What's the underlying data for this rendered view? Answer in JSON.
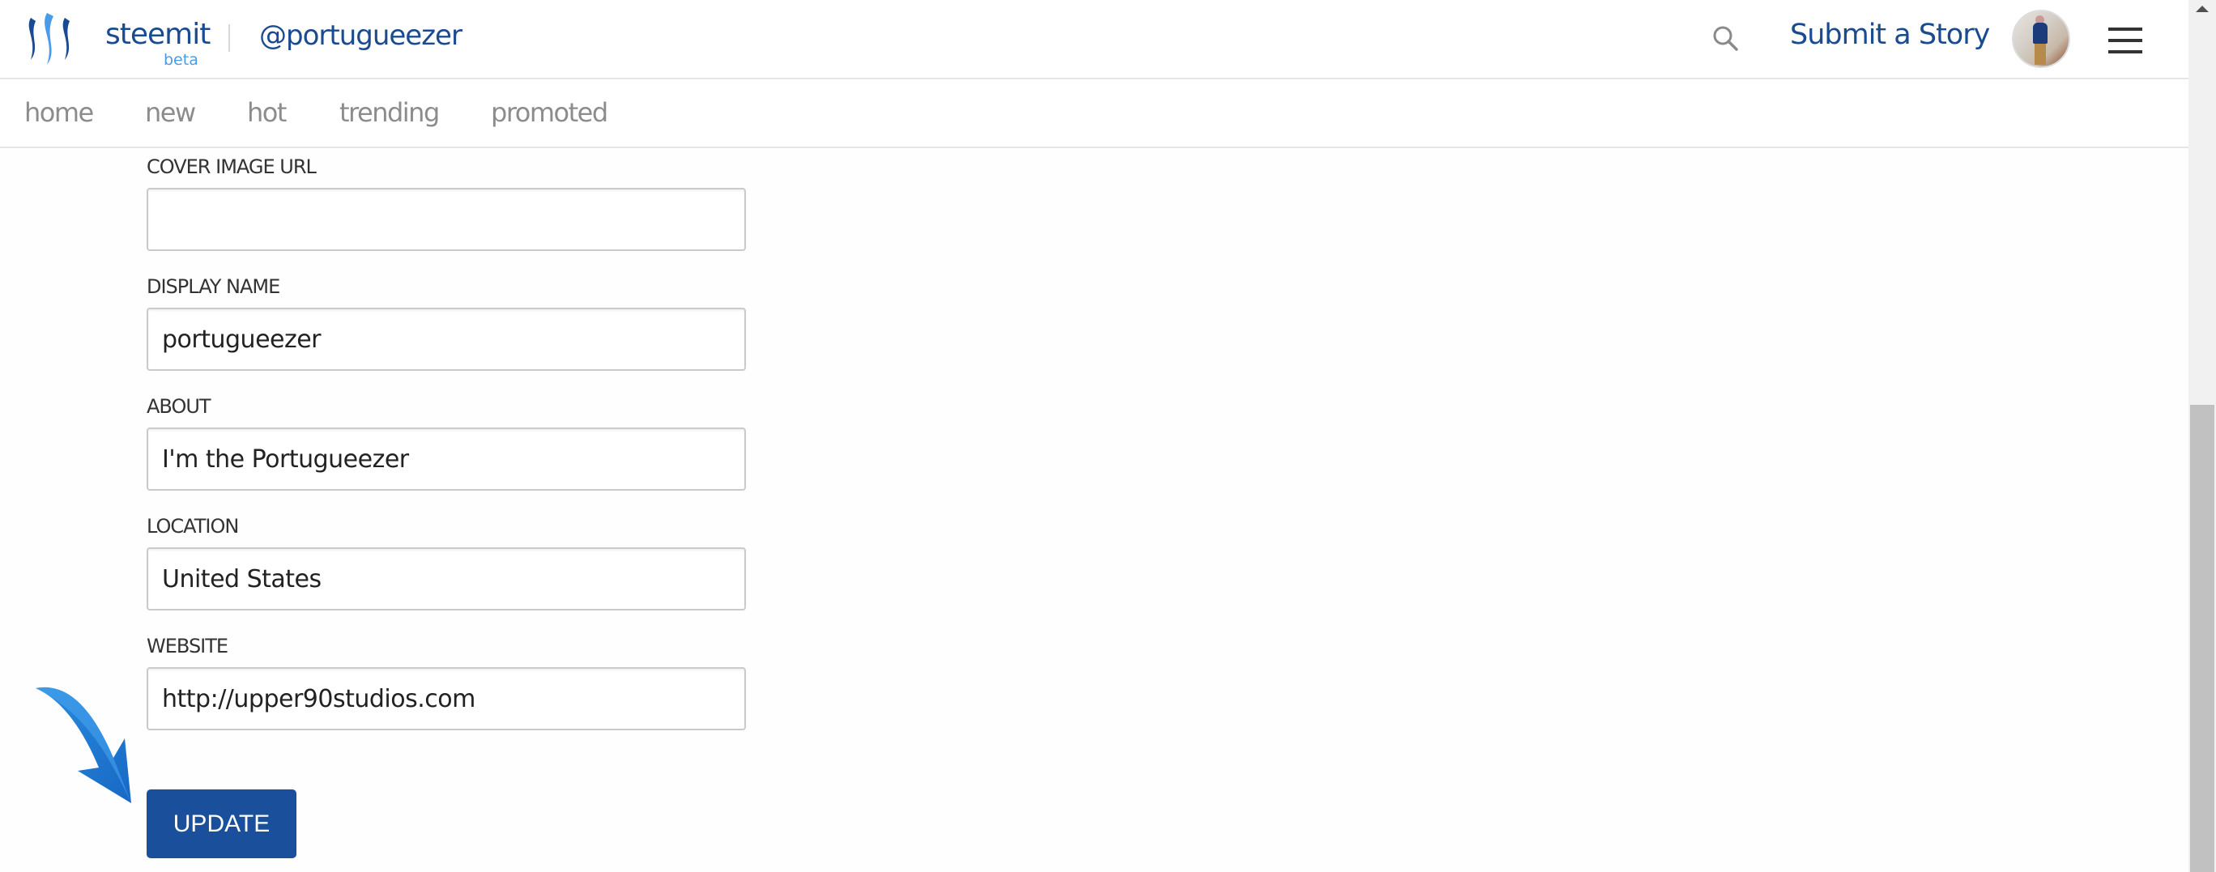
{
  "header": {
    "brand": "steemit",
    "brand_sub": "beta",
    "username": "@portugueezer",
    "submit_label": "Submit a Story",
    "icons": {
      "search": "search-icon",
      "menu": "hamburger-menu-icon",
      "logo": "steemit-logo-icon"
    }
  },
  "nav": {
    "items": [
      {
        "label": "home"
      },
      {
        "label": "new"
      },
      {
        "label": "hot"
      },
      {
        "label": "trending"
      },
      {
        "label": "promoted"
      }
    ]
  },
  "form": {
    "fields": [
      {
        "label": "COVER IMAGE URL",
        "value": ""
      },
      {
        "label": "DISPLAY NAME",
        "value": "portugueezer"
      },
      {
        "label": "ABOUT",
        "value": "I'm the Portugueezer"
      },
      {
        "label": "LOCATION",
        "value": "United States"
      },
      {
        "label": "WEBSITE",
        "value": "http://upper90studios.com"
      }
    ],
    "submit_label": "UPDATE"
  },
  "annotation": {
    "icon": "pointer-arrow-icon"
  },
  "colors": {
    "brand": "#1a4a8f",
    "beta": "#4a9be8",
    "button": "#1a4f9c",
    "nav_text": "#8c8c8c"
  }
}
